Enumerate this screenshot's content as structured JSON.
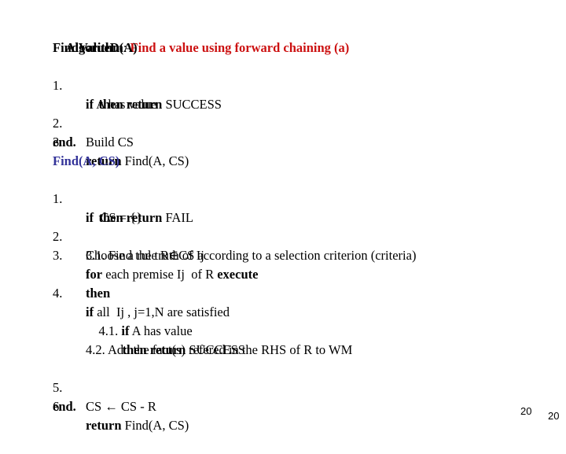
{
  "algorithm_label": "Algorithm",
  "algorithm_colon": ": ",
  "algorithm_title": "Find a value using forward chaining (a)",
  "proc1": {
    "signature": "FindValueD(A)",
    "steps": [
      {
        "num": "1.",
        "kw": "if",
        "text": " A has value"
      },
      {
        "kw": "then return",
        "text": " SUCCESS"
      },
      {
        "num": "2.",
        "text": "Build CS"
      },
      {
        "num": "3.",
        "kw": "return",
        "text": " Find(A, CS)"
      }
    ],
    "end": "end."
  },
  "proc2": {
    "signature": "Find(A, CS)",
    "steps": [
      {
        "num": "1.",
        "kw": "if",
        "text": "  CS = {}"
      },
      {
        "kw": "then return",
        "text": " FAIL"
      },
      {
        "num": "2.",
        "text": "Choose a rule R∈CS according to a selection criterion (criteria)"
      },
      {
        "num": "3.",
        "kw": "for",
        "text": " each premise Ij  of R ",
        "kw2": "execute"
      },
      {
        "text": "3.1. Find the truth of Ij"
      },
      {
        "num": "4.",
        "kw": "if",
        "text": " all  Ij , j=1,N are satisfied"
      },
      {
        "kw": "then"
      },
      {
        "pre": "4.1. ",
        "kw": "if",
        "text": " A has value"
      },
      {
        "kw": "then return",
        "text": " SUCCESS"
      },
      {
        "text": "4.2. Add the fact(s) refered in the RHS of R to WM"
      },
      {
        "num": "5.",
        "text": "CS ← CS - R"
      },
      {
        "num": "6.",
        "kw": "return",
        "text": " Find(A, CS)"
      }
    ],
    "end": "end."
  },
  "page_numbers": [
    "20",
    "20"
  ]
}
